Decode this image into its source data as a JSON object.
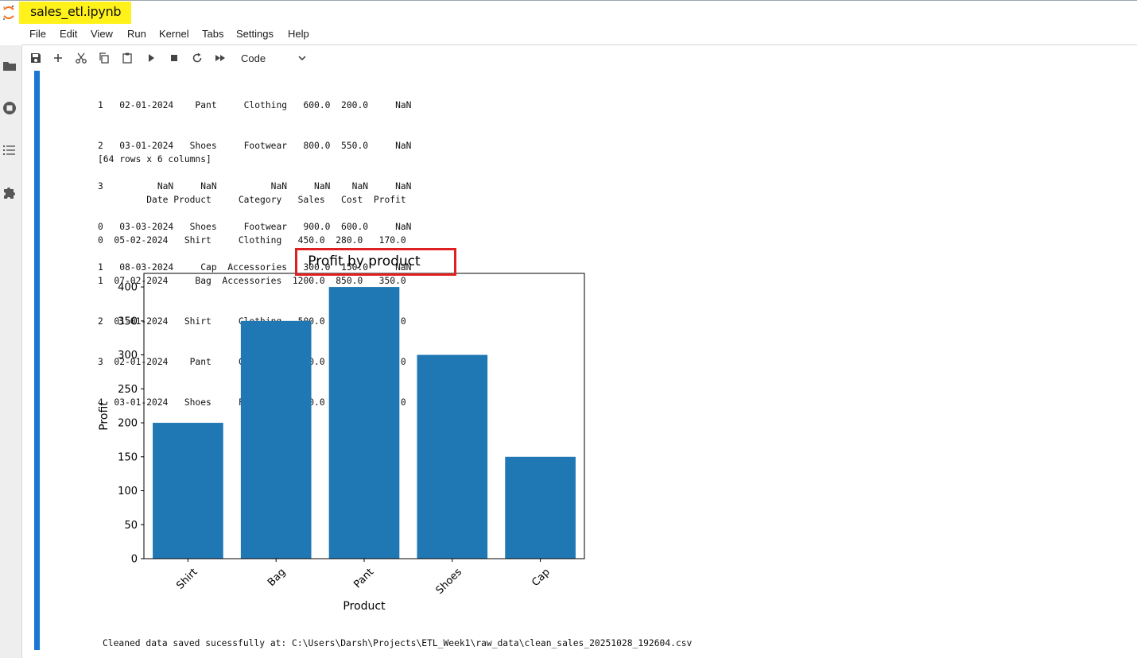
{
  "app": {
    "notebook_title": "sales_etl.ipynb"
  },
  "menu": {
    "items": [
      "File",
      "Edit",
      "View",
      "Run",
      "Kernel",
      "Tabs",
      "Settings",
      "Help"
    ]
  },
  "toolbar": {
    "cell_type": "Code",
    "icons": [
      "save-icon",
      "plus-icon",
      "scissors-icon",
      "copy-icon",
      "paste-icon",
      "run-icon",
      "stop-icon",
      "restart-icon",
      "fast-forward-icon"
    ]
  },
  "sidebar": {
    "icons": [
      "folder-icon",
      "running-icon",
      "toc-icon",
      "extension-icon"
    ]
  },
  "output": {
    "table1_rows": [
      "1   02-01-2024    Pant     Clothing   600.0  200.0     NaN",
      "2   03-01-2024   Shoes     Footwear   800.0  550.0     NaN",
      "3          NaN     NaN          NaN     NaN    NaN     NaN",
      "0   03-03-2024   Shoes     Footwear   900.0  600.0     NaN",
      "1   08-03-2024     Cap  Accessories   300.0  150.0     NaN"
    ],
    "shape_line": "[64 rows x 6 columns]",
    "table2_header": "         Date Product     Category   Sales   Cost  Profit",
    "table2_rows": [
      "0  05-02-2024   Shirt     Clothing   450.0  280.0   170.0",
      "1  07-02-2024     Bag  Accessories  1200.0  850.0   350.0",
      "2  01-01-2024   Shirt     Clothing   500.0  300.0   200.0",
      "3  02-01-2024    Pant     Clothing   600.0  200.0   400.0",
      "4  03-01-2024   Shoes     Footwear   800.0  550.0   250.0"
    ],
    "saved_message": "Cleaned data saved sucessfully at: C:\\Users\\Darsh\\Projects\\ETL_Week1\\raw_data\\clean_sales_20251028_192604.csv"
  },
  "chart_data": {
    "type": "bar",
    "title": "Profit by product",
    "xlabel": "Product",
    "ylabel": "Profit",
    "categories": [
      "Shirt",
      "Bag",
      "Pant",
      "Shoes",
      "Cap"
    ],
    "values": [
      200,
      350,
      400,
      300,
      150
    ],
    "ylim": [
      0,
      420
    ],
    "yticks": [
      0,
      50,
      100,
      150,
      200,
      250,
      300,
      350,
      400
    ],
    "bar_color": "#1f77b4",
    "highlight_color": "#e02020",
    "grid": false,
    "legend": "none"
  },
  "colors": {
    "cell_marker": "#1976d2",
    "title_highlight": "#fff21a"
  }
}
